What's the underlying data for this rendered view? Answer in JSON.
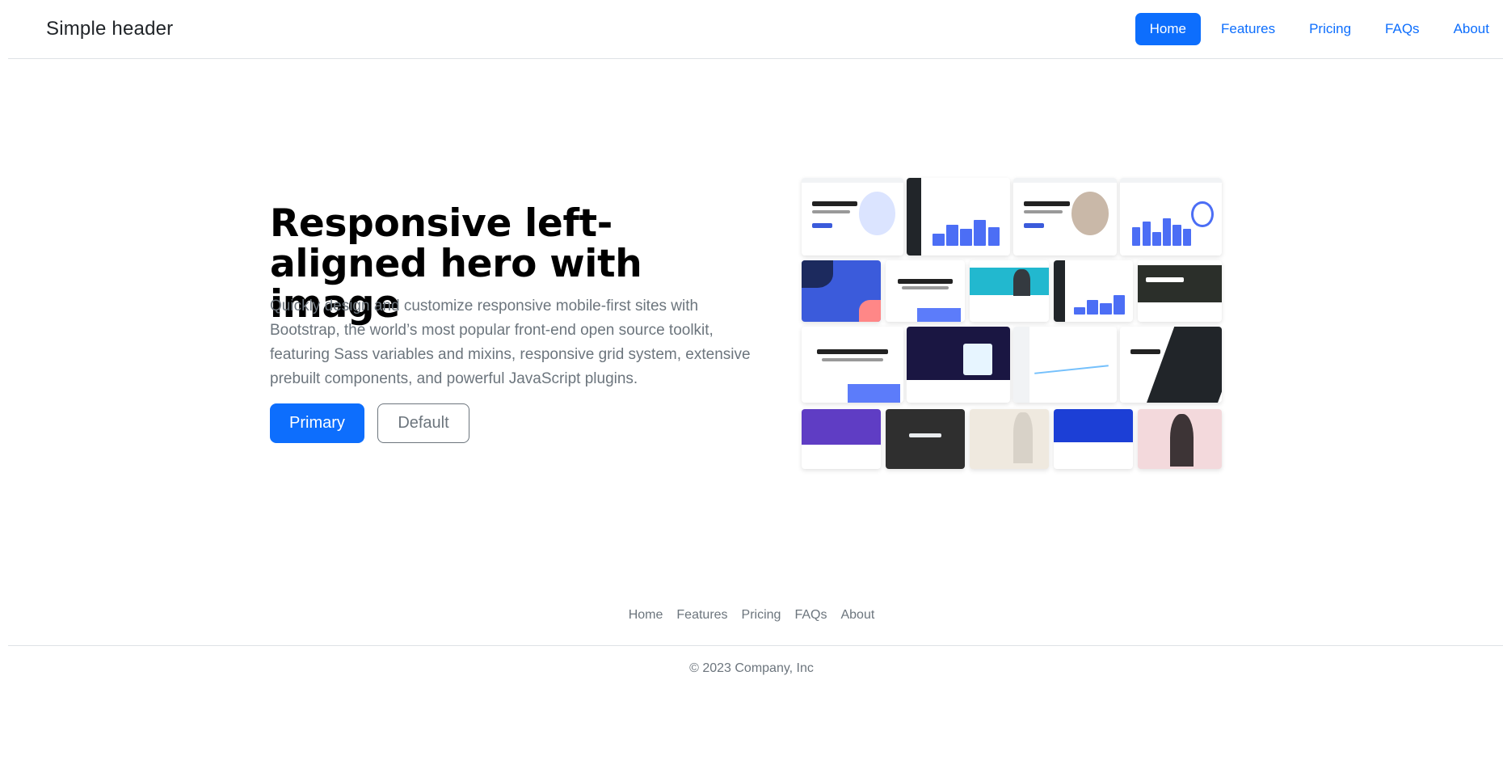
{
  "header": {
    "brand": "Simple header",
    "nav": [
      {
        "label": "Home",
        "active": true
      },
      {
        "label": "Features",
        "active": false
      },
      {
        "label": "Pricing",
        "active": false
      },
      {
        "label": "FAQs",
        "active": false
      },
      {
        "label": "About",
        "active": false
      }
    ]
  },
  "hero": {
    "title": "Responsive left-aligned hero with image",
    "lead": "Quickly design and customize responsive mobile-first sites with Bootstrap, the world’s most popular front-end open source toolkit, featuring Sass variables and mixins, responsive grid system, extensive prebuilt components, and powerful JavaScript plugins.",
    "primary_label": "Primary",
    "default_label": "Default"
  },
  "footer": {
    "links": [
      "Home",
      "Features",
      "Pricing",
      "FAQs",
      "About"
    ],
    "copyright": "© 2023 Company, Inc"
  },
  "colors": {
    "accent": "#0d6efd",
    "muted": "#6c757d",
    "border": "#dee2e6"
  }
}
